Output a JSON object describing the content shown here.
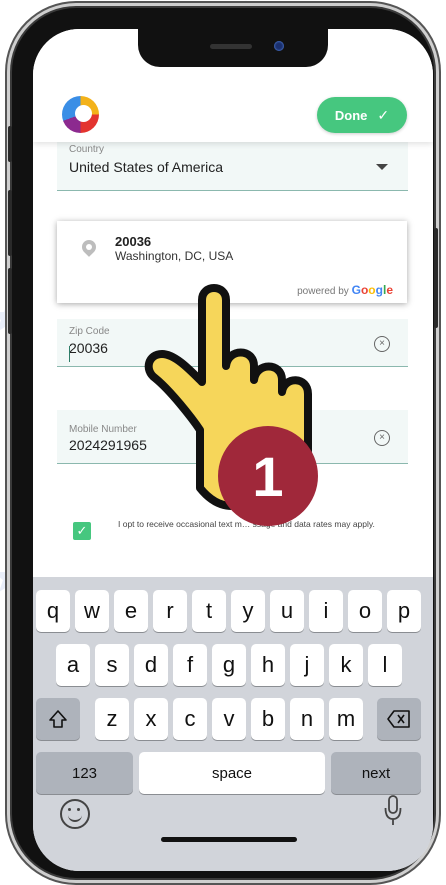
{
  "header": {
    "done_label": "Done"
  },
  "country": {
    "label": "Country",
    "value": "United States of America"
  },
  "suggestion": {
    "title": "20036",
    "subtitle": "Washington, DC, USA",
    "powered_by": "powered by",
    "google": "Google"
  },
  "zip": {
    "label": "Zip Code",
    "value": "20036"
  },
  "mobile": {
    "label": "Mobile Number",
    "value": "2024291965"
  },
  "optin": {
    "checked": true,
    "text": "I opt to receive occasional text m… ssage and data rates may apply."
  },
  "keyboard": {
    "row1": [
      "q",
      "w",
      "e",
      "r",
      "t",
      "y",
      "u",
      "i",
      "o",
      "p"
    ],
    "row2": [
      "a",
      "s",
      "d",
      "f",
      "g",
      "h",
      "j",
      "k",
      "l"
    ],
    "row3": [
      "z",
      "x",
      "c",
      "v",
      "b",
      "n",
      "m"
    ],
    "mode_label": "123",
    "space_label": "space",
    "next_label": "next"
  },
  "step_badge": "1",
  "colors": {
    "accent": "#46c77f",
    "badge": "#a0283a",
    "hand": "#f6d65a"
  }
}
